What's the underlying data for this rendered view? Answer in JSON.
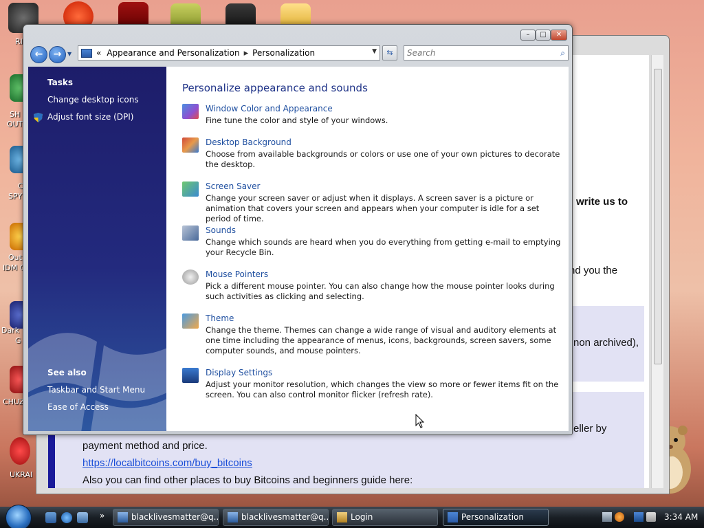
{
  "desktop": {
    "icon_labels": [
      "RI",
      "SH",
      "OUT",
      "C",
      "SPY",
      "Out",
      "IDM C",
      "Dark",
      "G",
      "CHUZ",
      "UKRAI"
    ]
  },
  "background_window": {
    "text_write": "write us to",
    "text_you_the": "nd you the",
    "text_archived": "non archived),",
    "text_seller": "eller by",
    "text_payment": "payment method and price.",
    "link": "https://localbitcoins.com/buy_bitcoins",
    "text_guide": "Also you can find other places to buy Bitcoins and beginners guide here:"
  },
  "window": {
    "minimize_label": "–",
    "maximize_label": "□",
    "close_label": "✕"
  },
  "nav": {
    "back_glyph": "←",
    "forward_glyph": "→",
    "history_glyph": "▼"
  },
  "address": {
    "prefix": "«",
    "crumbs": [
      "Appearance and Personalization",
      "Personalization"
    ],
    "separator": "▸",
    "drop": "▼"
  },
  "refresh_glyph": "⇆",
  "search": {
    "placeholder": "Search",
    "icon_glyph": "⌕"
  },
  "sidebar": {
    "tasks_heading": "Tasks",
    "tasks": [
      "Change desktop icons",
      "Adjust font size (DPI)"
    ],
    "see_also_heading": "See also",
    "see_also": [
      "Taskbar and Start Menu",
      "Ease of Access"
    ]
  },
  "main": {
    "title": "Personalize appearance and sounds",
    "items": [
      {
        "title": "Window Color and Appearance",
        "desc": "Fine tune the color and style of your windows."
      },
      {
        "title": "Desktop Background",
        "desc": "Choose from available backgrounds or colors or use one of your own pictures to decorate the desktop."
      },
      {
        "title": "Screen Saver",
        "desc": "Change your screen saver or adjust when it displays. A screen saver is a picture or animation that covers your screen and appears when your computer is idle for a set period of time."
      },
      {
        "title": "Sounds",
        "desc": "Change which sounds are heard when you do everything from getting e-mail to emptying your Recycle Bin."
      },
      {
        "title": "Mouse Pointers",
        "desc": "Pick a different mouse pointer. You can also change how the mouse pointer looks during such activities as clicking and selecting."
      },
      {
        "title": "Theme",
        "desc": "Change the theme. Themes can change a wide range of visual and auditory elements at one time including the appearance of menus, icons, backgrounds, screen savers, some computer sounds, and mouse pointers."
      },
      {
        "title": "Display Settings",
        "desc": "Adjust your monitor resolution, which changes the view so more or fewer items fit on the screen. You can also control monitor flicker (refresh rate)."
      }
    ]
  },
  "taskbar": {
    "more_glyph": "»",
    "buttons": [
      {
        "label": "blacklivesmatter@q...",
        "active": false
      },
      {
        "label": "blacklivesmatter@q...",
        "active": false
      },
      {
        "label": "Login",
        "active": false
      },
      {
        "label": "Personalization",
        "active": true
      }
    ],
    "clock": "3:34 AM"
  },
  "colors": {
    "link_blue": "#1f4fa0",
    "sidebar_navy": "#1d1d6a",
    "title_blue": "#1e3287"
  }
}
